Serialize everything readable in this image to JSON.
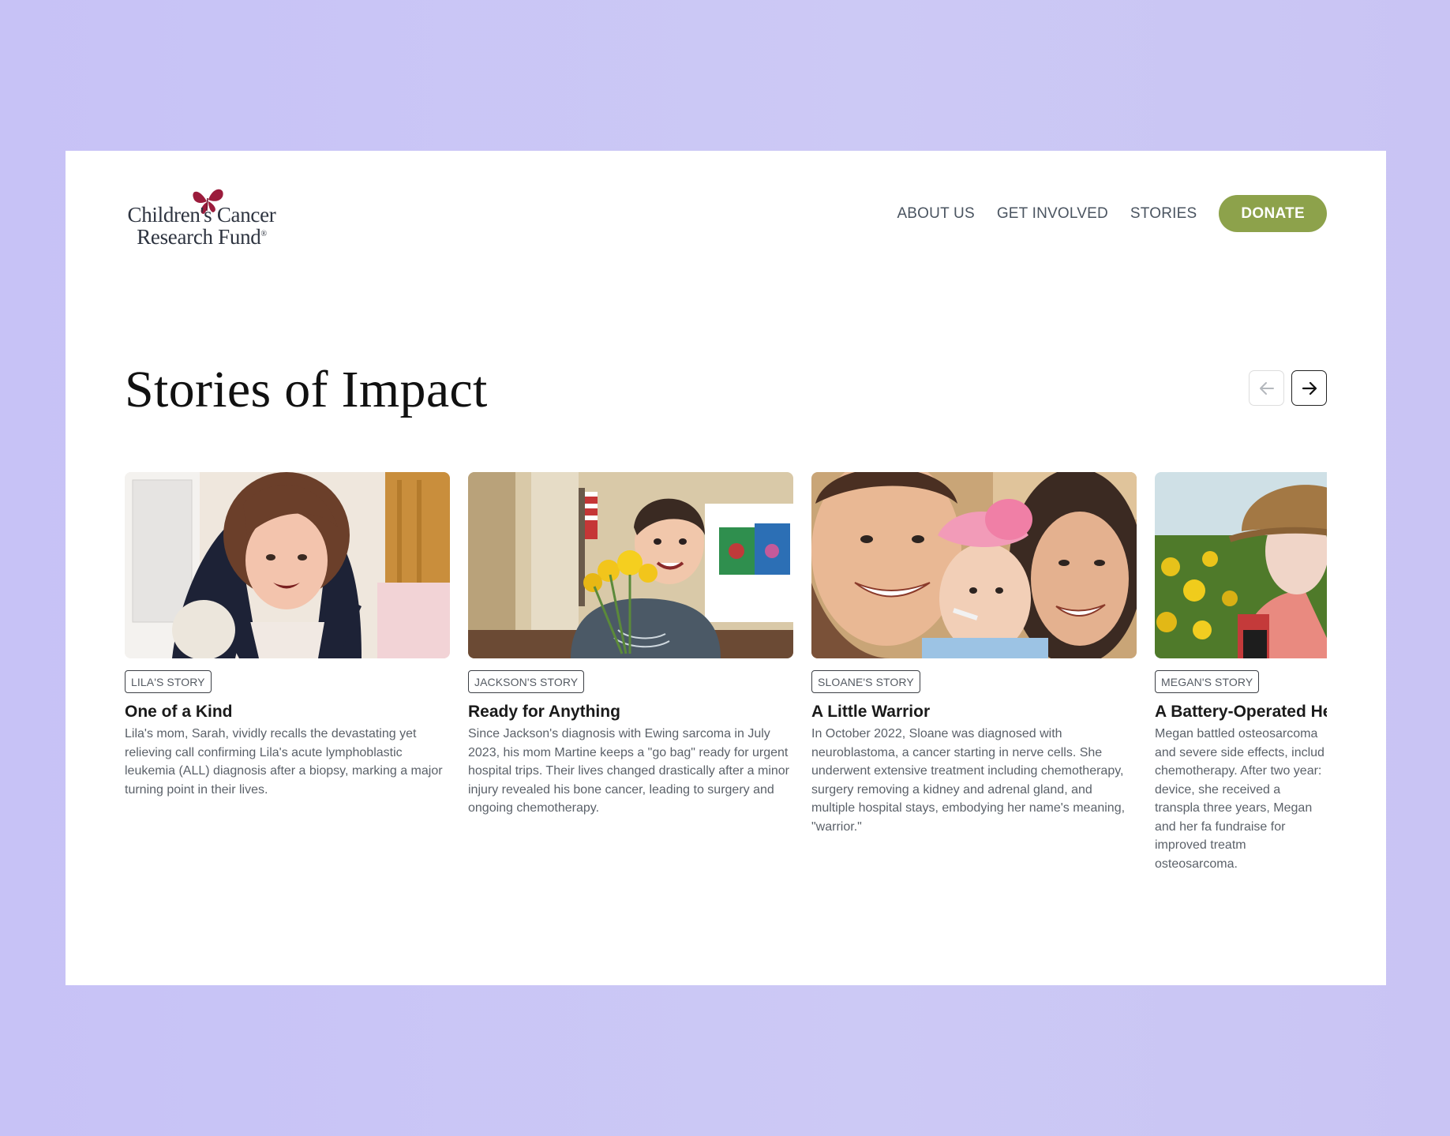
{
  "brand": {
    "logo_line1": "Children's Cancer",
    "logo_line2": "Research Fund",
    "logo_mark": "butterfly-icon",
    "color": "#9b1c3c"
  },
  "nav": {
    "items": [
      {
        "label": "ABOUT US"
      },
      {
        "label": "GET INVOLVED"
      },
      {
        "label": "STORIES"
      }
    ],
    "donate_label": "DONATE",
    "donate_color": "#8da24b"
  },
  "section": {
    "title": "Stories of Impact",
    "prev_icon": "arrow-left-icon",
    "next_icon": "arrow-right-icon"
  },
  "stories": [
    {
      "badge": "LILA'S STORY",
      "title": "One of a Kind",
      "text": "Lila's mom, Sarah, vividly recalls the devastating yet relieving call confirming Lila's acute lymphoblastic leukemia (ALL) diagnosis after a biopsy, marking a major turning point in their lives."
    },
    {
      "badge": "JACKSON'S STORY",
      "title": "Ready for Anything",
      "text": "Since Jackson's diagnosis with Ewing sarcoma in July 2023, his mom Martine keeps a \"go bag\" ready for urgent hospital trips. Their lives changed drastically after a minor injury revealed his bone cancer, leading to surgery and ongoing chemotherapy."
    },
    {
      "badge": "SLOANE'S STORY",
      "title": "A Little Warrior",
      "text": "In October 2022, Sloane was diagnosed with neuroblastoma, a cancer starting in nerve cells. She underwent extensive treatment including chemotherapy, surgery removing a kidney and adrenal gland, and multiple hospital stays, embodying her name's meaning, \"warrior.\""
    },
    {
      "badge": "MEGAN'S STORY",
      "title": "A Battery-Operated He",
      "text": "Megan battled osteosarcoma and severe side effects, includ chemotherapy. After two year: device, she received a transpla three years, Megan and her fa fundraise for improved treatm osteosarcoma."
    }
  ]
}
